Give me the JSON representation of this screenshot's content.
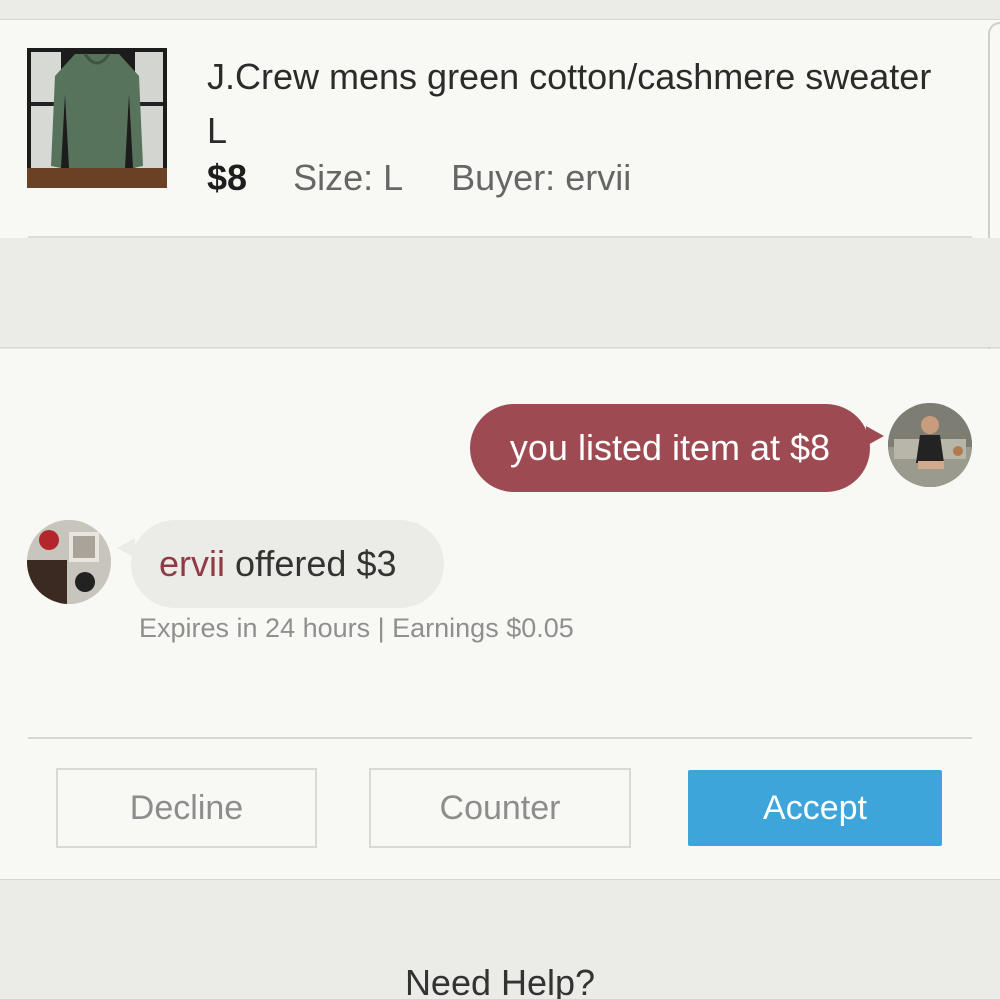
{
  "item": {
    "title": "J.Crew mens green cotton/cashmere sweater L",
    "price": "$8",
    "size": "Size: L",
    "buyer": "Buyer: ervii"
  },
  "chat": {
    "seller_message": "you listed item at $8",
    "buyer_name": "ervii",
    "offer_text": " offered $3",
    "offer_meta": "Expires in 24 hours | Earnings $0.05"
  },
  "actions": {
    "decline_label": "Decline",
    "counter_label": "Counter",
    "accept_label": "Accept"
  },
  "footer": {
    "help_label": "Need Help?"
  },
  "colors": {
    "accent_blue": "#3ea5da",
    "bubble_maroon": "#9e4a53",
    "buyer_name": "#8e3b46"
  }
}
